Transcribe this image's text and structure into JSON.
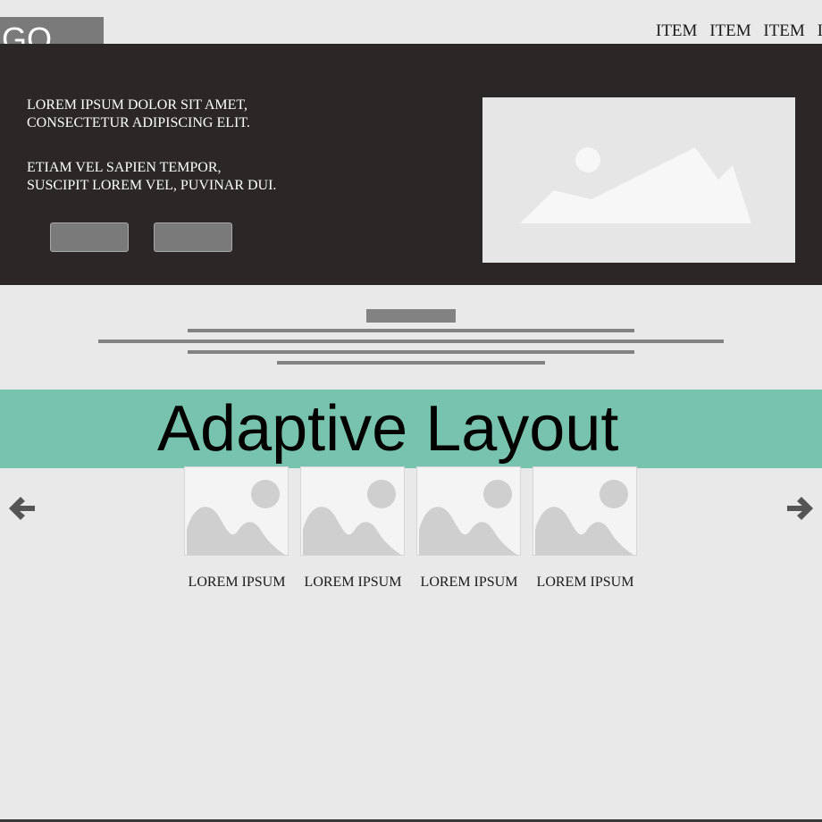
{
  "header": {
    "logo_text": "GO",
    "nav_items": [
      "ITEM",
      "ITEM",
      "ITEM",
      "IT"
    ]
  },
  "hero": {
    "paragraph_1": "LOREM IPSUM DOLOR SIT AMET,\nCONSECTETUR ADIPISCING ELIT.",
    "paragraph_2": "ETIAM VEL SAPIEN TEMPOR,\nSUSCIPIT LOREM VEL, PUVINAR DUI.",
    "image_icon": "image-placeholder-icon"
  },
  "banner": {
    "title": "Adaptive Layout"
  },
  "carousel": {
    "prev_icon": "arrow-left-icon",
    "next_icon": "arrow-right-icon",
    "items": [
      {
        "label": "LOREM IPSUM"
      },
      {
        "label": "LOREM IPSUM"
      },
      {
        "label": "LOREM IPSUM"
      },
      {
        "label": "LOREM IPSUM"
      }
    ]
  },
  "colors": {
    "page_background": "#e9e9e9",
    "hero_background": "#2b2727",
    "banner_accent": "#77c3ae",
    "placeholder_gray": "#7b7a7a"
  }
}
